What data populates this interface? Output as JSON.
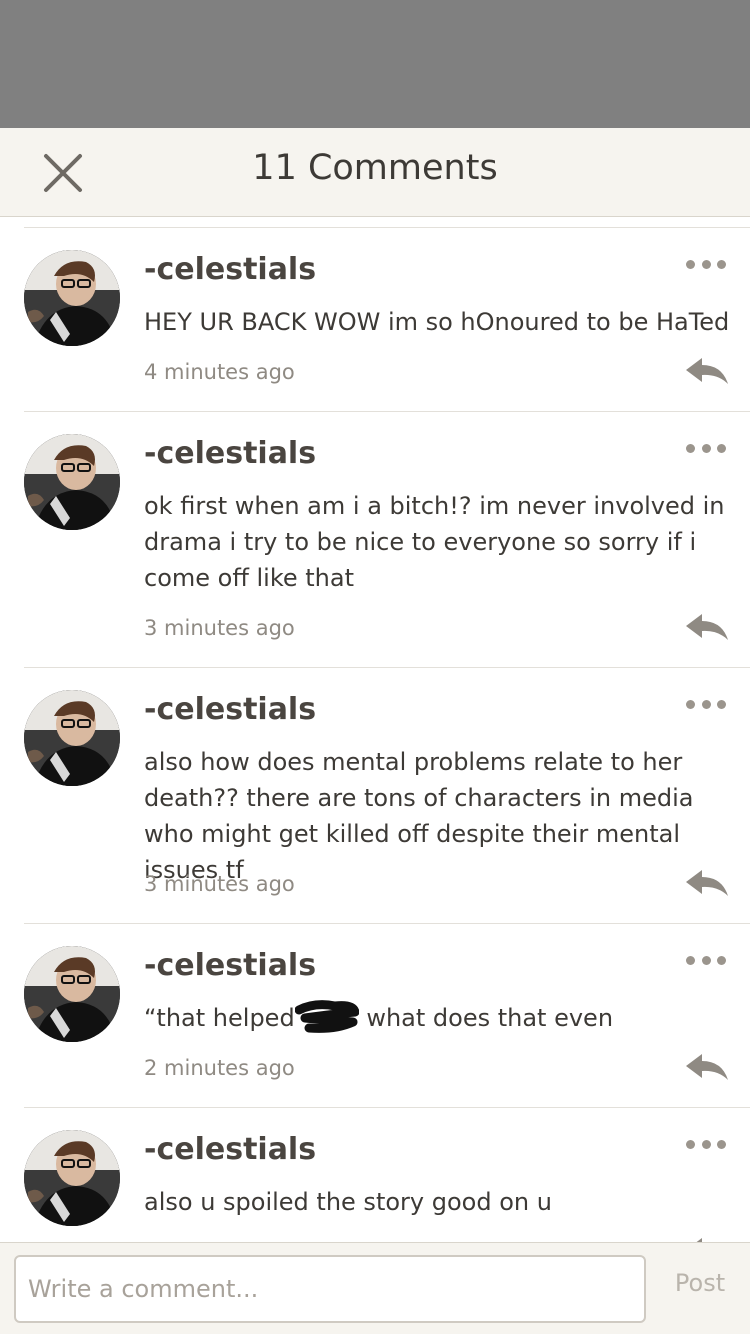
{
  "header": {
    "title": "11 Comments",
    "close_icon": "close-icon"
  },
  "comments": [
    {
      "user": "-celestials",
      "text": "HEY UR BACK WOW im so hOnoured to be HaTed",
      "time": "4 minutes ago"
    },
    {
      "user": "-celestials",
      "text": "ok first when am i a bitch!? im never involved in drama i try to be nice to everyone so sorry if i come off like that",
      "time": "3 minutes ago"
    },
    {
      "user": "-celestials",
      "text": "also how does mental problems relate to her death?? there are tons of characters in media who might get killed off despite their mental issues tf",
      "time": "3 minutes ago"
    },
    {
      "user": "-celestials",
      "text_before": "“that helped",
      "text_after": " what does that even",
      "time": "2 minutes ago"
    },
    {
      "user": "-celestials",
      "text": "also u spoiled the story good on u",
      "time": ""
    }
  ],
  "footer": {
    "input_placeholder": "Write a comment...",
    "post_label": "Post"
  },
  "colors": {
    "header_bg": "#f6f4ef",
    "text": "#3d3a36",
    "muted": "#8f8a83",
    "icon": "#9b958d",
    "overlay": "#808080"
  }
}
